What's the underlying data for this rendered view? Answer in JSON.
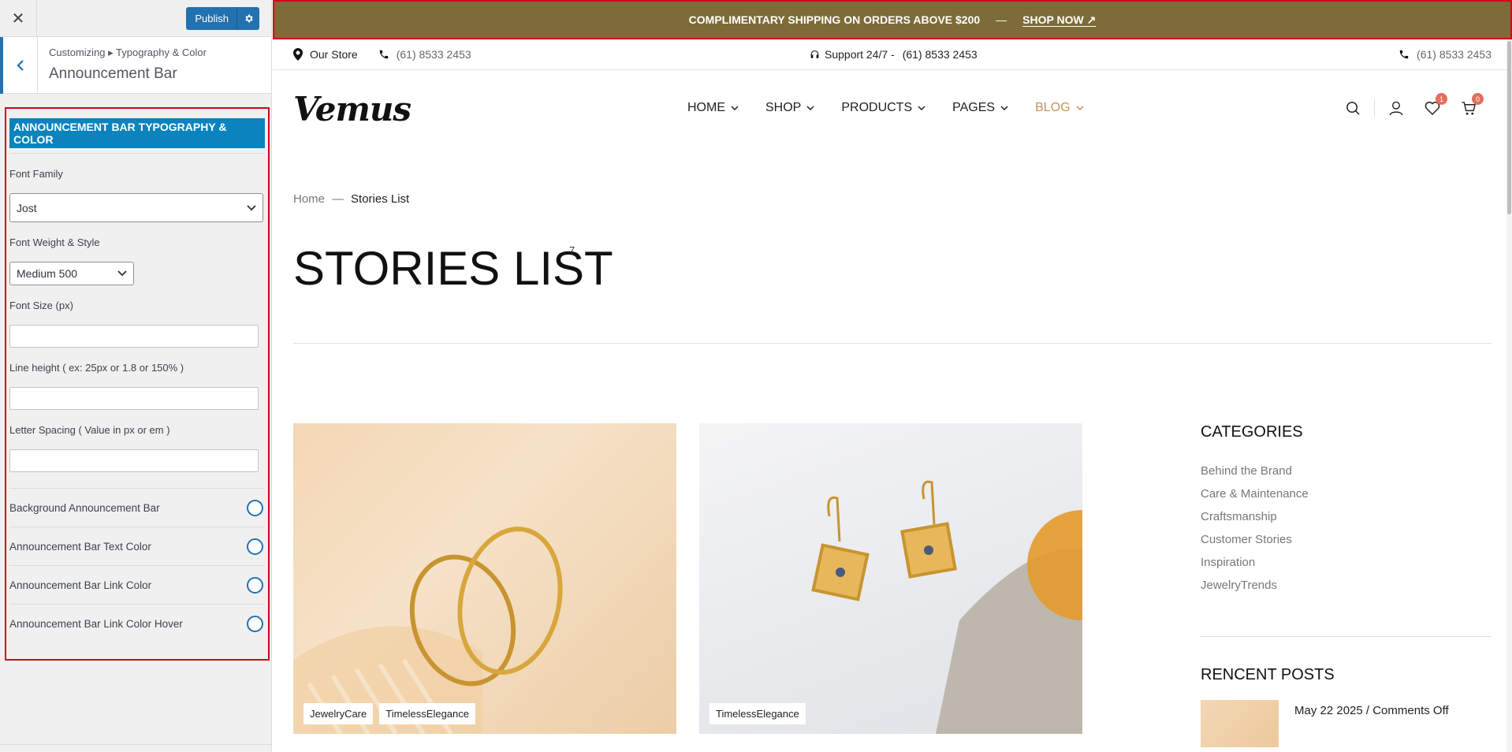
{
  "customizer": {
    "close_label": "✕",
    "publish_label": "Publish",
    "breadcrumb": "Customizing ▸ Typography & Color",
    "section_title": "Announcement Bar",
    "panel_heading": "ANNOUNCEMENT BAR TYPOGRAPHY & COLOR",
    "font_family_label": "Font Family",
    "font_family_value": "Jost",
    "font_weight_label": "Font Weight & Style",
    "font_weight_value": "Medium 500",
    "font_size_label": "Font Size (px)",
    "font_size_value": "",
    "line_height_label": "Line height ( ex: 25px or 1.8 or 150% )",
    "line_height_value": "",
    "letter_spacing_label": "Letter Spacing ( Value in px or em )",
    "letter_spacing_value": "",
    "colors": [
      {
        "label": "Background Announcement Bar"
      },
      {
        "label": "Announcement Bar Text Color"
      },
      {
        "label": "Announcement Bar Link Color"
      },
      {
        "label": "Announcement Bar Link Color Hover"
      }
    ],
    "accent_color": "#2271b1",
    "highlight_color": "#d0021b"
  },
  "site": {
    "announcement": {
      "text": "COMPLIMENTARY SHIPPING ON ORDERS ABOVE $200",
      "dash": "—",
      "link": "SHOP NOW ↗",
      "background": "#7d6b38"
    },
    "topbar": {
      "store": "Our Store",
      "phone_left": "(61) 8533 2453",
      "support": "Support 24/7 -",
      "support_phone": "(61) 8533 2453",
      "phone_right": "(61) 8533 2453"
    },
    "logo": "Vemus",
    "nav": [
      {
        "label": "HOME"
      },
      {
        "label": "SHOP"
      },
      {
        "label": "PRODUCTS"
      },
      {
        "label": "PAGES"
      },
      {
        "label": "BLOG"
      }
    ],
    "wishlist_count": "1",
    "cart_count": "0",
    "breadcrumb": {
      "home": "Home",
      "sep": "—",
      "current": "Stories List"
    },
    "page_title": "STORIES LIST",
    "page_count": "7",
    "posts": [
      {
        "tags": [
          "JewelryCare",
          "TimelessElegance"
        ]
      },
      {
        "tags": [
          "TimelessElegance"
        ]
      }
    ],
    "categories_title": "CATEGORIES",
    "categories": [
      "Behind the Brand",
      "Care & Maintenance",
      "Craftsmanship",
      "Customer Stories",
      "Inspiration",
      "JewelryTrends"
    ],
    "recent_title": "RENCENT POSTS",
    "recent_post_meta": "May 22 2025 / Comments Off",
    "accent_color": "#c19451"
  }
}
